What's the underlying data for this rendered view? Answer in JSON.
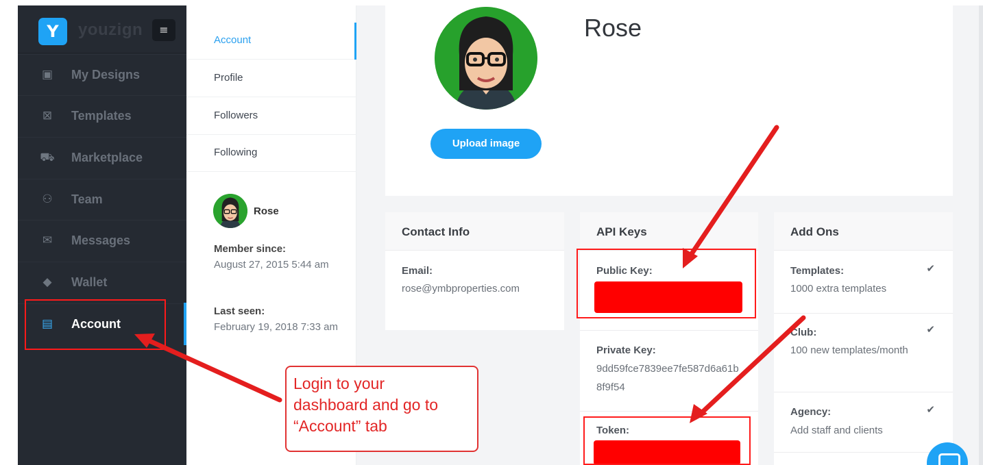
{
  "app": {
    "brand": "youzign",
    "logo_glyph": "Y",
    "menu_icon": "hamburger-icon"
  },
  "sidebar": {
    "items": [
      {
        "label": "My Designs",
        "icon": "image-icon",
        "glyph": "▣"
      },
      {
        "label": "Templates",
        "icon": "templates-icon",
        "glyph": "⊠"
      },
      {
        "label": "Marketplace",
        "icon": "cart-icon",
        "glyph": "⛟"
      },
      {
        "label": "Team",
        "icon": "team-icon",
        "glyph": "⚇"
      },
      {
        "label": "Messages",
        "icon": "envelope-icon",
        "glyph": "✉"
      },
      {
        "label": "Wallet",
        "icon": "tag-icon",
        "glyph": "◆"
      },
      {
        "label": "Account",
        "icon": "id-card-icon",
        "glyph": "▤",
        "active": true
      }
    ]
  },
  "subnav": {
    "items": [
      "Account",
      "Profile",
      "Followers",
      "Following"
    ],
    "active": "Account"
  },
  "user": {
    "name": "Rose",
    "member_since_label": "Member since:",
    "member_since": "August 27, 2015 5:44 am",
    "last_seen_label": "Last seen:",
    "last_seen": "February 19, 2018 7:33 am"
  },
  "profile": {
    "name": "Rose",
    "upload_label": "Upload image"
  },
  "contact": {
    "title": "Contact Info",
    "email_label": "Email:",
    "email": "rose@ymbproperties.com"
  },
  "api_keys": {
    "title": "API Keys",
    "public_key_label": "Public Key:",
    "private_key_label": "Private Key:",
    "private_key": "9dd59fce7839ee7fe587d6a61b8f9f54",
    "token_label": "Token:"
  },
  "addons": {
    "title": "Add Ons",
    "items": [
      {
        "name": "Templates:",
        "desc": "1000 extra templates",
        "checked": true
      },
      {
        "name": "Club:",
        "desc": "100 new templates/month",
        "checked": true
      },
      {
        "name": "Agency:",
        "desc": "Add staff and clients",
        "checked": true
      }
    ]
  },
  "annotation": {
    "callout_lines": [
      "Login to your",
      "dashboard and go to",
      "“Account” tab"
    ],
    "color": "#e02020"
  },
  "colors": {
    "accent": "#1fa3f5",
    "sidebar_bg": "#252a32",
    "redaction": "#ff0000"
  }
}
